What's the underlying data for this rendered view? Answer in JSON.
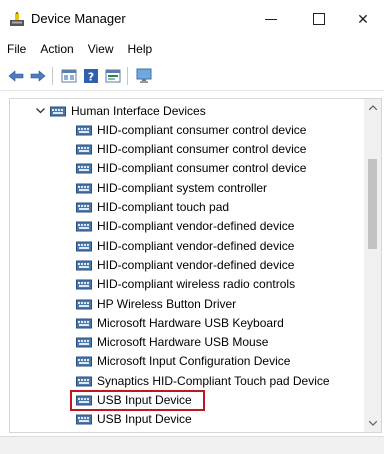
{
  "window": {
    "title": "Device Manager",
    "minimize_glyph": "",
    "maximize_glyph": "",
    "close_glyph": "✕"
  },
  "menu": {
    "items": [
      "File",
      "Action",
      "View",
      "Help"
    ]
  },
  "toolbar": {
    "icons": [
      "back-arrow-icon",
      "forward-arrow-icon",
      "properties-icon",
      "help-icon",
      "update-driver-icon",
      "monitor-icon"
    ]
  },
  "tree": {
    "category": "Human Interface Devices",
    "devices": [
      "HID-compliant consumer control device",
      "HID-compliant consumer control device",
      "HID-compliant consumer control device",
      "HID-compliant system controller",
      "HID-compliant touch pad",
      "HID-compliant vendor-defined device",
      "HID-compliant vendor-defined device",
      "HID-compliant vendor-defined device",
      "HID-compliant wireless radio controls",
      "HP Wireless Button Driver",
      "Microsoft Hardware USB Keyboard",
      "Microsoft Hardware USB Mouse",
      "Microsoft Input Configuration Device",
      "Synaptics HID-Compliant Touch pad Device",
      "USB Input Device",
      "USB Input Device"
    ],
    "highlighted_index": 14
  },
  "colors": {
    "highlight": "#c0161f",
    "icon_blue": "#3a6ea5"
  }
}
